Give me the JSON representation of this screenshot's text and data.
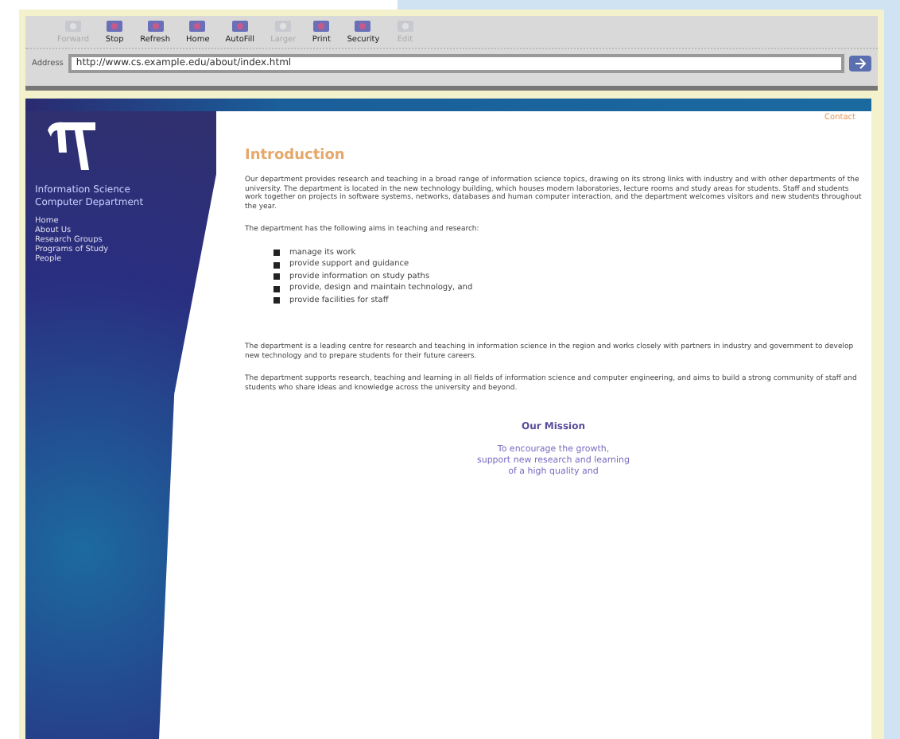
{
  "toolbar": {
    "buttons": [
      {
        "label": "Forward",
        "disabled": true
      },
      {
        "label": "Stop",
        "disabled": false
      },
      {
        "label": "Refresh",
        "disabled": false
      },
      {
        "label": "Home",
        "disabled": false
      },
      {
        "label": "AutoFill",
        "disabled": false
      },
      {
        "label": "Larger",
        "disabled": true
      },
      {
        "label": "Print",
        "disabled": false
      },
      {
        "label": "Security",
        "disabled": false
      },
      {
        "label": "Edit",
        "disabled": true
      }
    ]
  },
  "address_bar": {
    "label": "Address",
    "value": "http://www.cs.example.edu/about/index.html"
  },
  "page": {
    "sidebar": {
      "title_lines": [
        "Information Science",
        "Computer Department"
      ],
      "links": [
        "Home",
        "About Us",
        "Research Groups",
        "Programs of Study",
        "People"
      ]
    },
    "top_link": "Contact",
    "heading": "Introduction",
    "paragraphs": [
      "Our department provides research and teaching in a broad range of information science topics, drawing on its strong links with industry and with other departments of the university. The department is located in the new technology building, which houses modern laboratories, lecture rooms and study areas for students. Staff and students work together on projects in software systems, networks, databases and human computer interaction, and the department welcomes visitors and new students throughout the year.",
      "The department has the following aims in teaching and research:"
    ],
    "bullets": [
      "manage its work",
      "provide support and guidance",
      "provide information on study paths",
      "provide, design and maintain technology, and",
      "provide facilities for staff"
    ],
    "paragraphs_after": [
      "The department is a leading centre for research and teaching in information science in the region and works closely with partners in industry and government to develop new technology and to prepare students for their future careers.",
      "The department supports research, teaching and learning in all fields of information science and computer engineering, and aims to build a strong community of staff and students who share ideas and knowledge across the university and beyond."
    ],
    "mission": {
      "heading": "Our Mission",
      "lines": [
        "To encourage the growth,",
        "support new research and learning",
        "of a high quality and"
      ]
    }
  }
}
